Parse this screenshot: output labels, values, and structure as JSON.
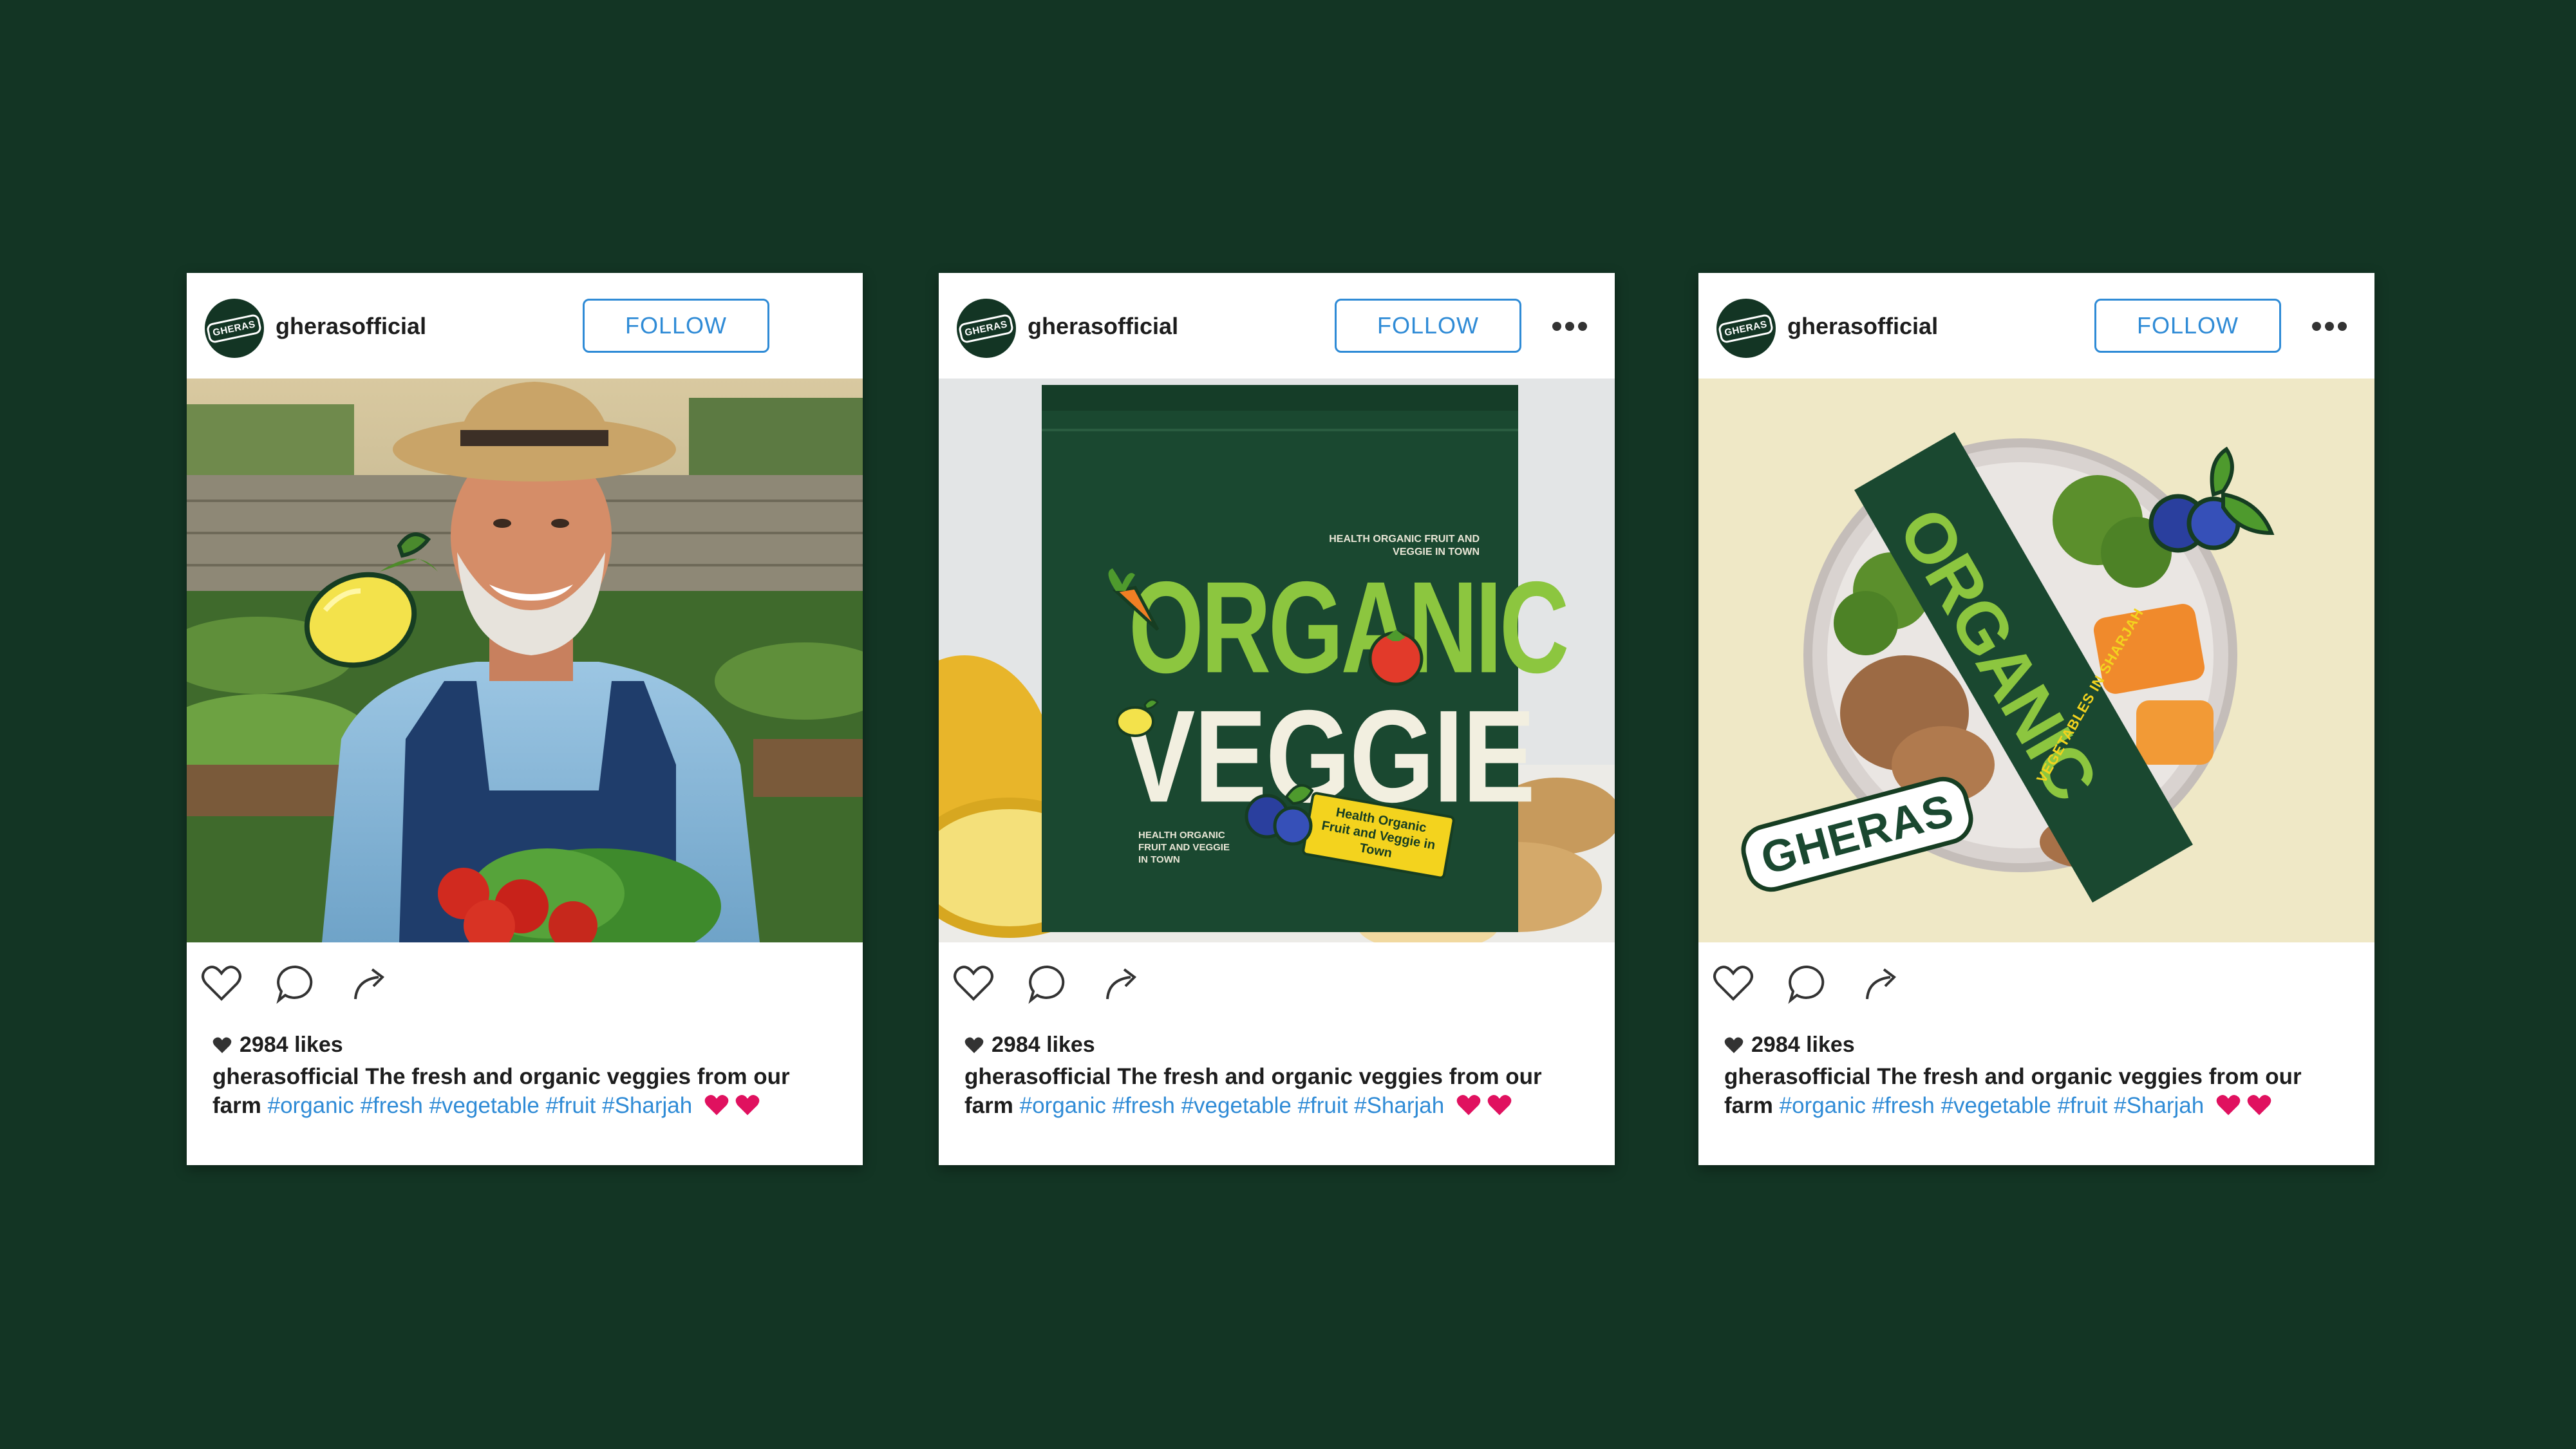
{
  "posts": [
    {
      "username": "gherasofficial",
      "avatar_text": "GHERAS",
      "follow_label": "FOLLOW",
      "likes": "2984 likes",
      "caption_user": "gherasofficial",
      "caption_text": "The fresh and organic veggies from our farm",
      "hashtags": "#organic #fresh #vegetable #fruit #Sharjah",
      "photo": "farmer-with-vegetables",
      "show_more_icon": false
    },
    {
      "username": "gherasofficial",
      "avatar_text": "GHERAS",
      "follow_label": "FOLLOW",
      "likes": "2984 likes",
      "caption_user": "gherasofficial",
      "caption_text": "The fresh and organic veggies from our farm",
      "hashtags": "#organic #fresh #vegetable #fruit #Sharjah",
      "photo": "organic-veggie-pouch",
      "show_more_icon": true,
      "pouch": {
        "tagline_top": "HEALTH ORGANIC FRUIT AND VEGGIE IN TOWN",
        "title_line1": "ORGANIC",
        "title_line2": "VEGGIE",
        "tagline_bottom": "HEALTH ORGANIC FRUIT AND VEGGIE IN TOWN",
        "sticker": "Health Organic Fruit and Veggie in Town"
      }
    },
    {
      "username": "gherasofficial",
      "avatar_text": "GHERAS",
      "follow_label": "FOLLOW",
      "likes": "2984 likes",
      "caption_user": "gherasofficial",
      "caption_text": "The fresh and organic veggies from our farm",
      "hashtags": "#organic #fresh #vegetable #fruit #Sharjah",
      "photo": "salad-bowl-with-sleeve",
      "show_more_icon": true,
      "bowl": {
        "brand": "GHERAS",
        "sleeve_title": "ORGANIC",
        "sleeve_sub": "VEGETABLES IN SHARJAH"
      }
    }
  ],
  "colors": {
    "background": "#133524",
    "brand_green": "#1d4a30",
    "follow_blue": "#2f8bd6",
    "heart_pink": "#e0115f",
    "lime": "#8cc63f"
  },
  "icons": [
    "heart-icon",
    "comment-icon",
    "share-icon",
    "more-icon",
    "lemon-icon",
    "blueberry-icon",
    "carrot-icon",
    "tomato-icon"
  ]
}
